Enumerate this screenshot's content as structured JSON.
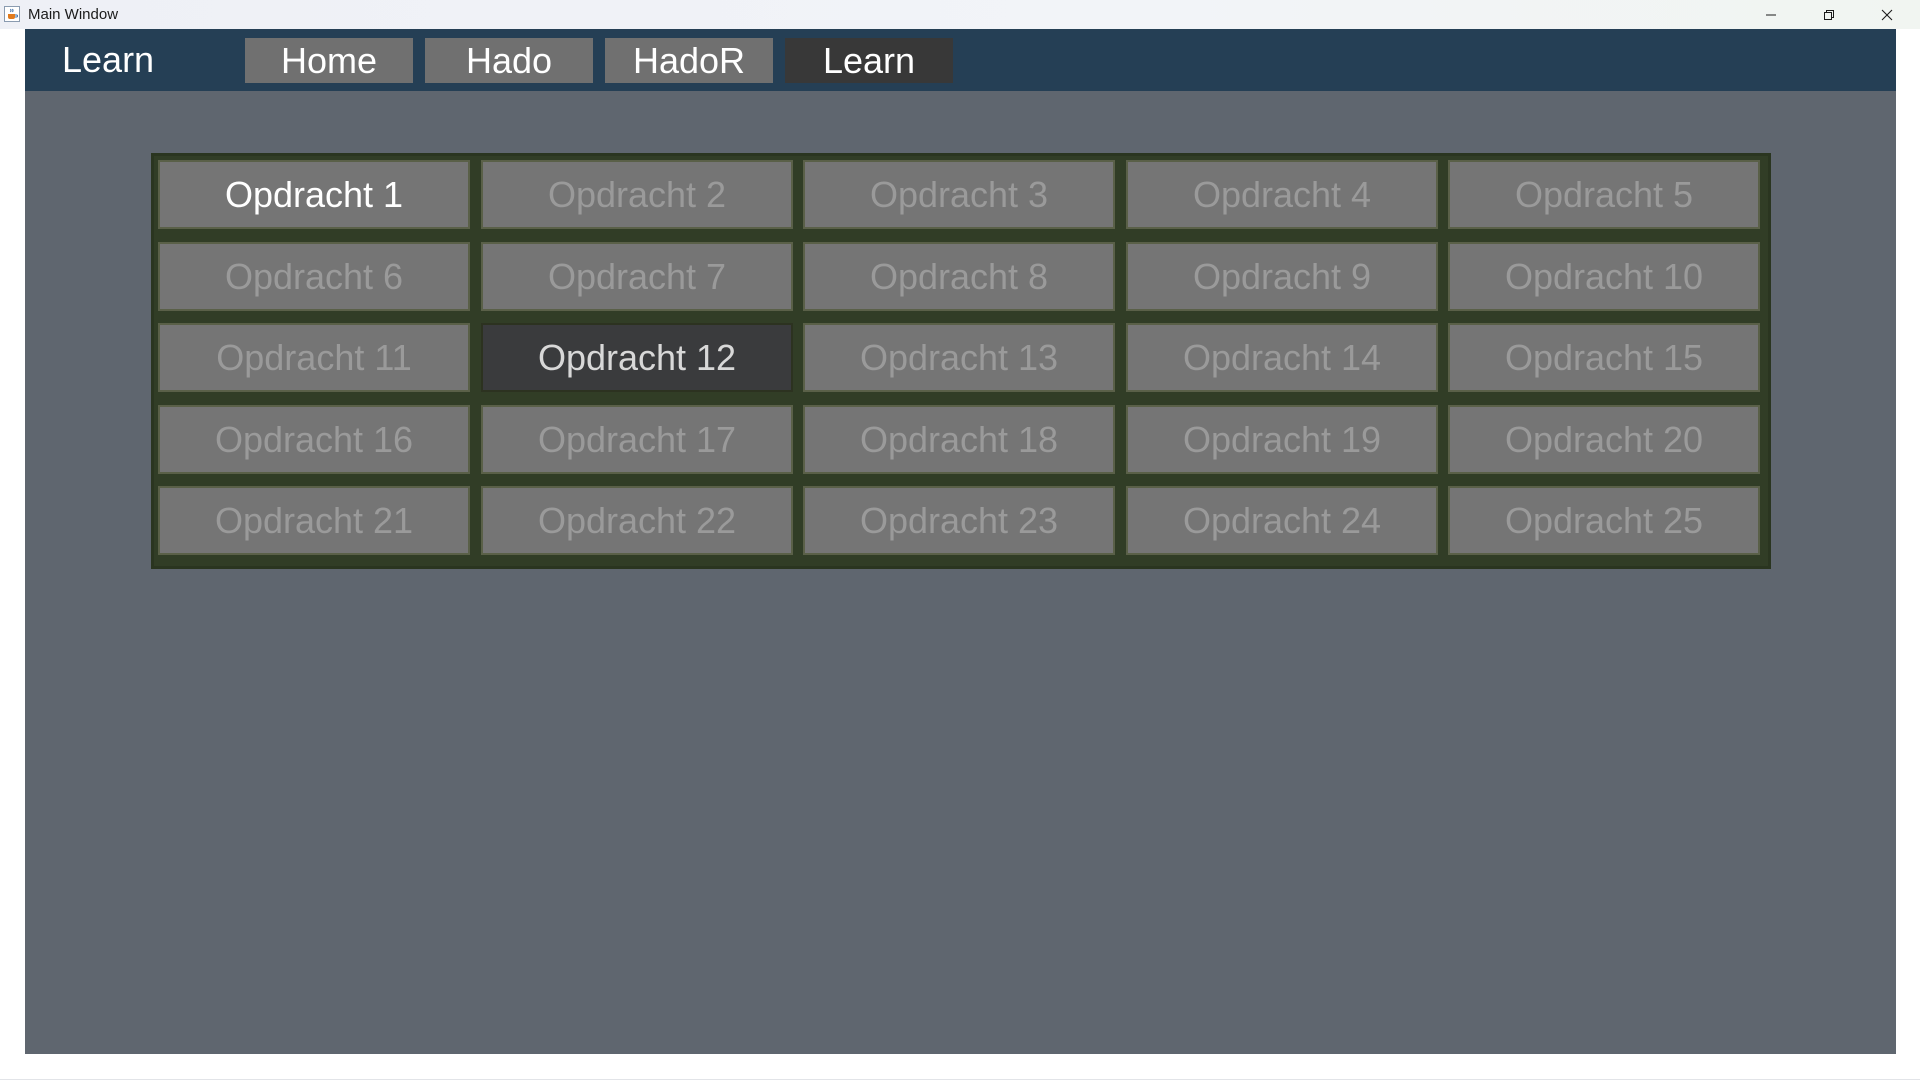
{
  "window": {
    "title": "Main Window",
    "app_icon": "java-coffee-icon",
    "controls": [
      "minimize-icon",
      "restore-icon",
      "close-icon"
    ]
  },
  "header": {
    "title": "Learn",
    "nav": [
      {
        "label": "Home",
        "active": false
      },
      {
        "label": "Hado",
        "active": false
      },
      {
        "label": "HadoR",
        "active": false
      },
      {
        "label": "Learn",
        "active": true
      }
    ]
  },
  "tasks": {
    "columns": 5,
    "items": [
      {
        "label": "Opdracht 1",
        "state": "unlocked"
      },
      {
        "label": "Opdracht 2",
        "state": "locked"
      },
      {
        "label": "Opdracht 3",
        "state": "locked"
      },
      {
        "label": "Opdracht 4",
        "state": "locked"
      },
      {
        "label": "Opdracht 5",
        "state": "locked"
      },
      {
        "label": "Opdracht 6",
        "state": "locked"
      },
      {
        "label": "Opdracht 7",
        "state": "locked"
      },
      {
        "label": "Opdracht 8",
        "state": "locked"
      },
      {
        "label": "Opdracht 9",
        "state": "locked"
      },
      {
        "label": "Opdracht 10",
        "state": "locked"
      },
      {
        "label": "Opdracht 11",
        "state": "locked"
      },
      {
        "label": "Opdracht 12",
        "state": "selected"
      },
      {
        "label": "Opdracht 13",
        "state": "locked"
      },
      {
        "label": "Opdracht 14",
        "state": "locked"
      },
      {
        "label": "Opdracht 15",
        "state": "locked"
      },
      {
        "label": "Opdracht 16",
        "state": "locked"
      },
      {
        "label": "Opdracht 17",
        "state": "locked"
      },
      {
        "label": "Opdracht 18",
        "state": "locked"
      },
      {
        "label": "Opdracht 19",
        "state": "locked"
      },
      {
        "label": "Opdracht 20",
        "state": "locked"
      },
      {
        "label": "Opdracht 21",
        "state": "locked"
      },
      {
        "label": "Opdracht 22",
        "state": "locked"
      },
      {
        "label": "Opdracht 23",
        "state": "locked"
      },
      {
        "label": "Opdracht 24",
        "state": "locked"
      },
      {
        "label": "Opdracht 25",
        "state": "locked"
      }
    ]
  },
  "colors": {
    "header_bg": "#253f55",
    "content_bg": "#5f666f",
    "nav_button_bg": "#707070",
    "nav_button_active_bg": "#383838",
    "grid_frame": "#313d26",
    "task_button_bg": "#757575",
    "task_locked_text": "#9a9a9a",
    "task_unlocked_text": "#ffffff",
    "task_selected_bg": "#3a3b3d"
  }
}
